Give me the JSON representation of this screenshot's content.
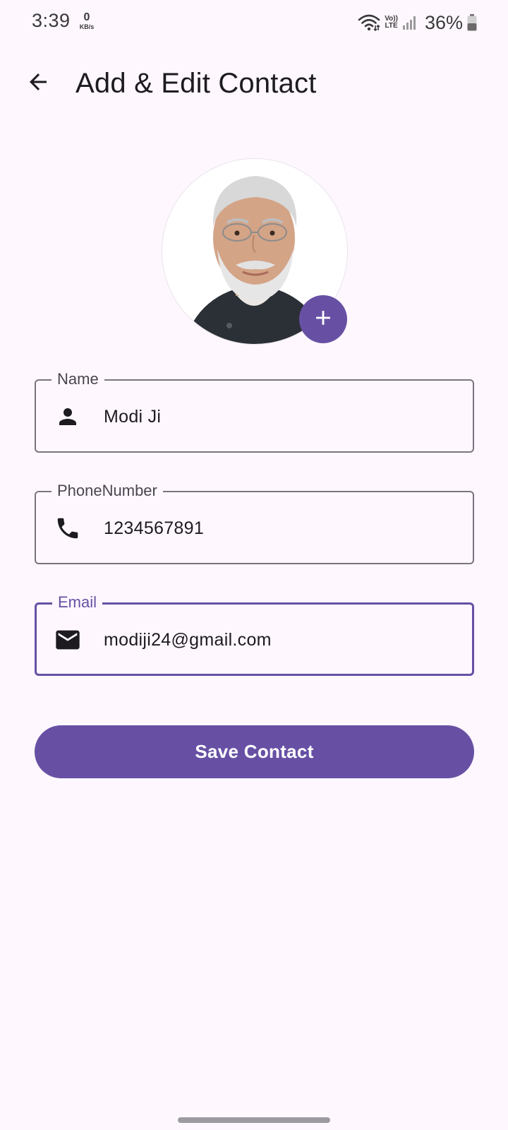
{
  "status_bar": {
    "time": "3:39",
    "net_speed_value": "0",
    "net_speed_unit": "KB/s",
    "volte_top": "Vo))",
    "volte_bottom": "LTE",
    "battery_text": "36%",
    "icons": [
      "wifi-icon",
      "signal-icon",
      "battery-icon"
    ]
  },
  "app_bar": {
    "title": "Add & Edit Contact",
    "back_icon": "arrow-back-icon"
  },
  "avatar": {
    "add_icon": "plus-icon"
  },
  "form": {
    "name": {
      "label": "Name",
      "value": "Modi Ji",
      "icon": "person-icon"
    },
    "phone": {
      "label": "PhoneNumber",
      "value": "1234567891",
      "icon": "phone-icon"
    },
    "email": {
      "label": "Email",
      "value": "modiji24@gmail.com",
      "icon": "mail-icon",
      "focused": true
    }
  },
  "actions": {
    "save_label": "Save Contact"
  },
  "colors": {
    "primary": "#6750A4",
    "background": "#FEF7FE",
    "outline": "#79747E",
    "on_surface": "#1D1B20"
  }
}
